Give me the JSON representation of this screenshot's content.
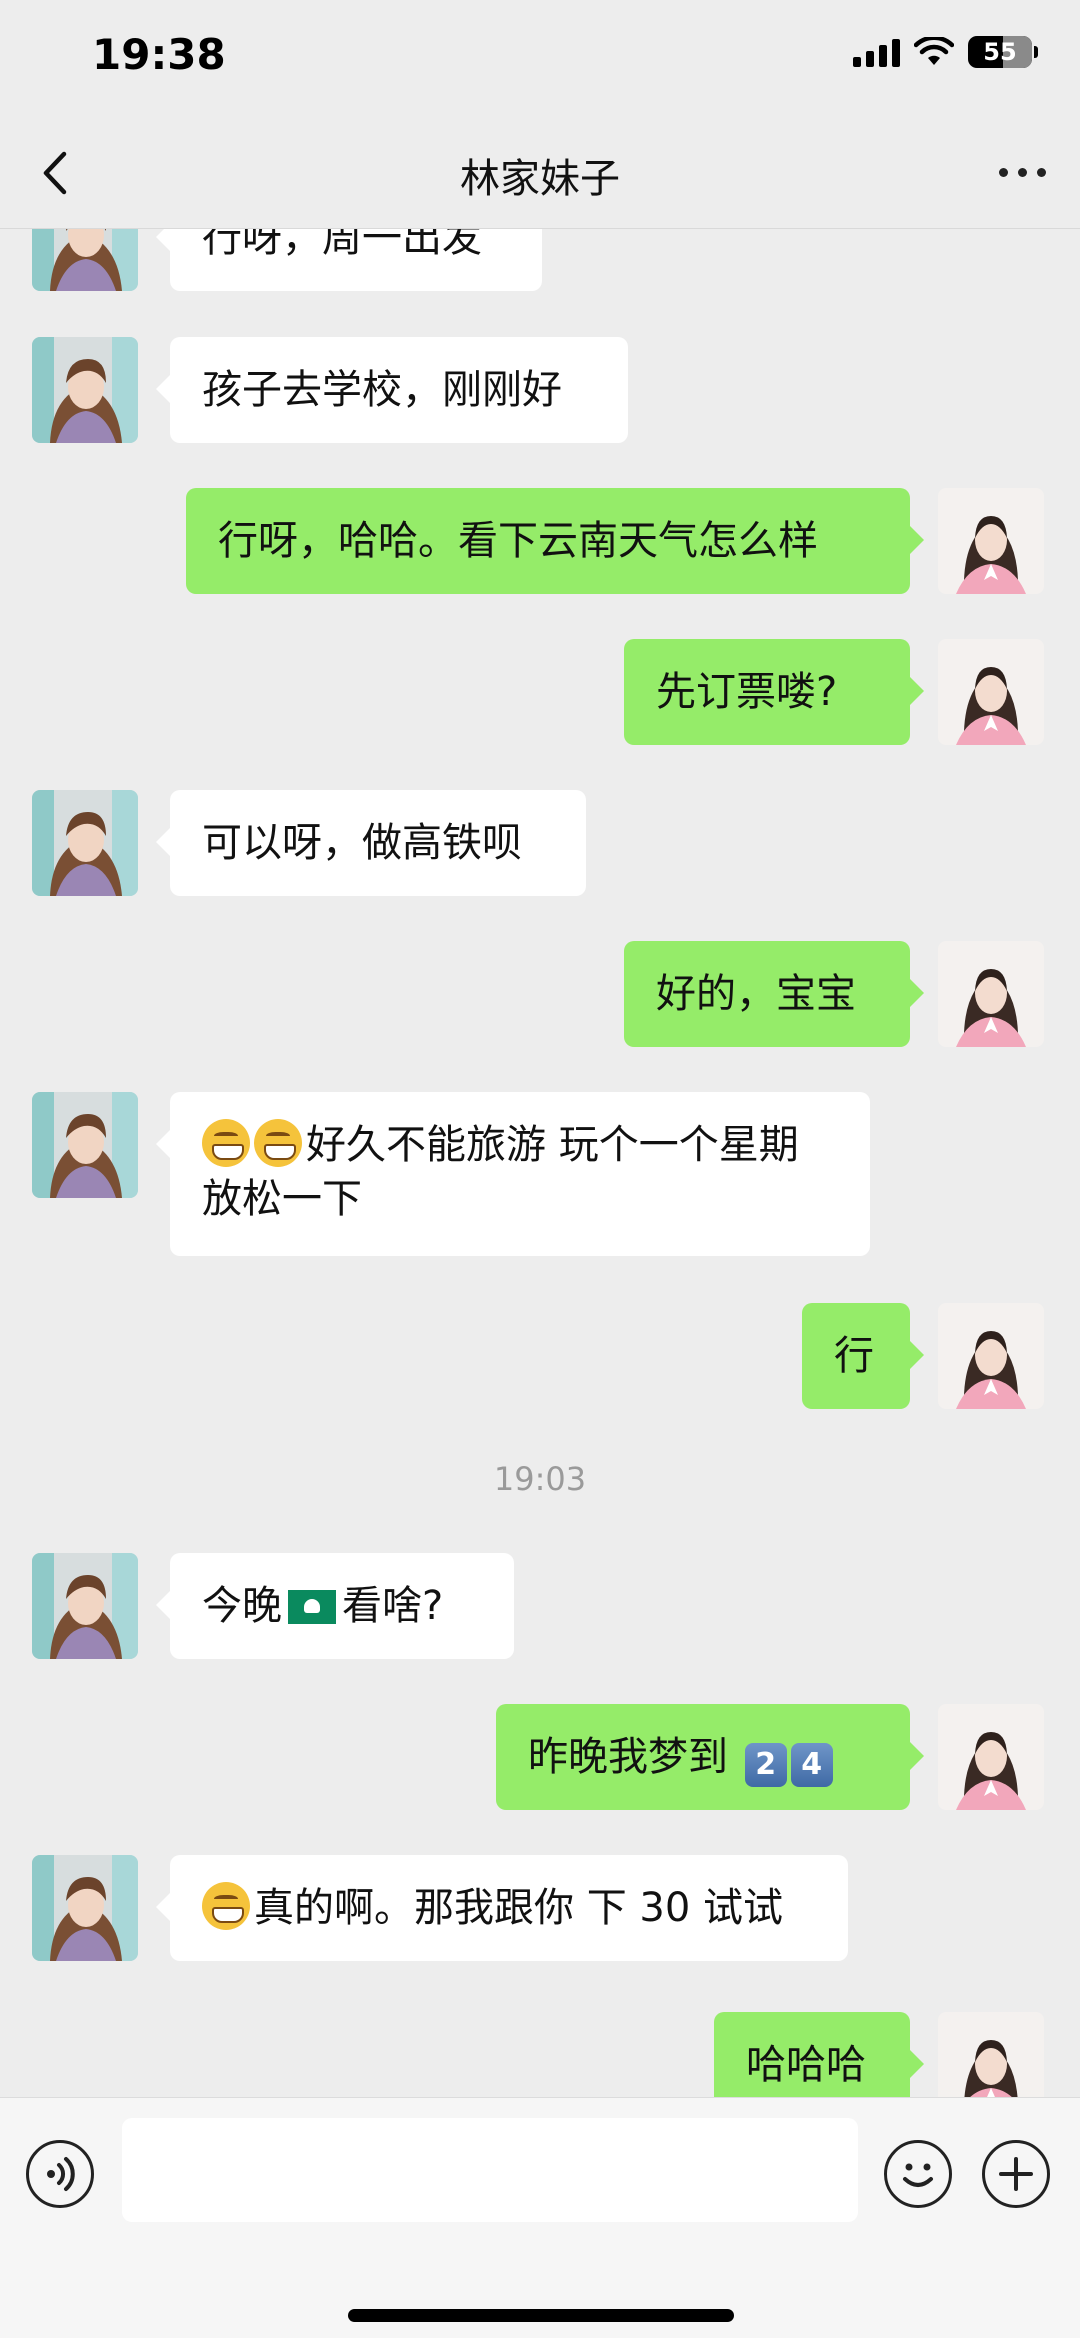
{
  "status_bar": {
    "time": "19:38",
    "battery": "55",
    "battery_level": 0.55
  },
  "header": {
    "title": "林家妹子",
    "back_icon": "chevron-left-icon",
    "more_icon": "more-dots-icon"
  },
  "colors": {
    "self_bubble": "#95ec69",
    "other_bubble": "#ffffff",
    "background": "#ededed"
  },
  "messages": [
    {
      "side": "left",
      "text": "行呀，周一出发"
    },
    {
      "side": "left",
      "text": "孩子去学校，刚刚好"
    },
    {
      "side": "right",
      "text": "行呀，哈哈。看下云南天气怎么样"
    },
    {
      "side": "right",
      "text": "先订票喽?"
    },
    {
      "side": "left",
      "text": "可以呀，做高铁呗"
    },
    {
      "side": "right",
      "text": "好的，宝宝"
    },
    {
      "side": "left",
      "text_line1": "好久不能旅游 玩个一个星期",
      "text_line2": "放松一下",
      "emoji": "grinning-face-icon"
    },
    {
      "side": "right",
      "text": "行"
    },
    {
      "side": "left",
      "text_before": "今晚",
      "text_after": "看啥?",
      "emoji": "macau-flag-icon"
    },
    {
      "side": "right",
      "text": "昨晚我梦到",
      "key1": "2",
      "key2": "4"
    },
    {
      "side": "left",
      "text": "真的啊。那我跟你 下 30 试试",
      "emoji": "grinning-face-icon"
    },
    {
      "side": "right",
      "text": "哈哈哈"
    }
  ],
  "time_divider": "19:03",
  "input_bar": {
    "value": "",
    "voice_icon": "voice-icon",
    "emoji_icon": "emoji-icon",
    "plus_icon": "plus-icon"
  }
}
